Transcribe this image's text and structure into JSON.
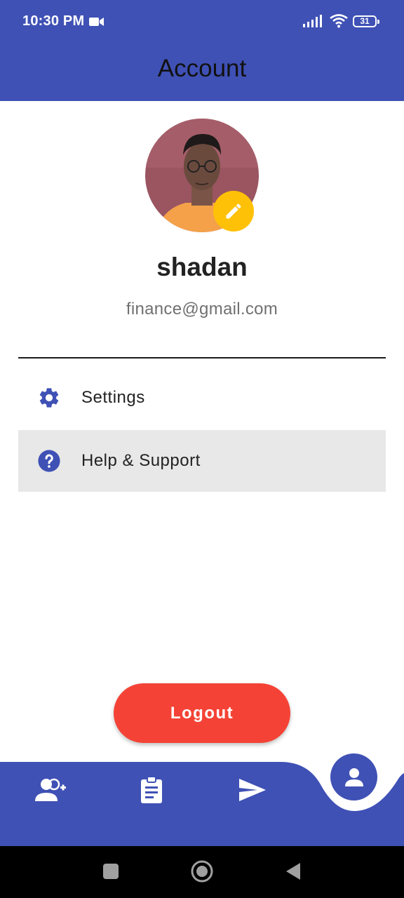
{
  "status_bar": {
    "time": "10:30 PM",
    "battery": "31",
    "icons": [
      "video-camera-icon",
      "signal-icon",
      "wifi-icon",
      "battery-icon"
    ]
  },
  "app_bar": {
    "title": "Account"
  },
  "profile": {
    "name": "shadan",
    "email": "finance@gmail.com",
    "edit_icon": "pencil-icon"
  },
  "menu": {
    "items": [
      {
        "label": "Settings",
        "icon": "gear-icon"
      },
      {
        "label": "Help & Support",
        "icon": "help-circle-icon",
        "highlighted": true
      }
    ]
  },
  "logout_label": "Logout",
  "bottom_nav": {
    "items": [
      {
        "icon": "add-user-icon"
      },
      {
        "icon": "clipboard-icon"
      },
      {
        "icon": "send-icon"
      },
      {
        "icon": "account-icon",
        "active": true
      }
    ]
  },
  "colors": {
    "primary": "#3f51b5",
    "accent": "#ffc107",
    "logout": "#f44336",
    "highlight": "#e8e8e8"
  }
}
